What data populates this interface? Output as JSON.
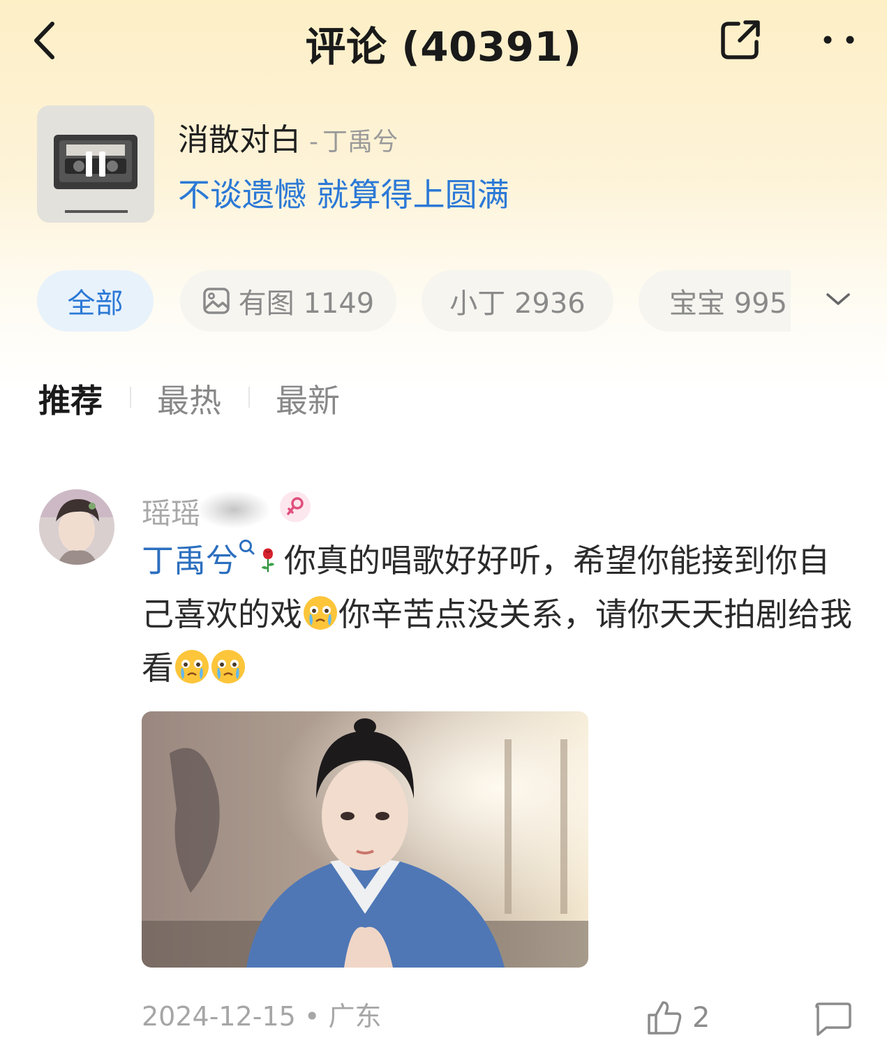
{
  "header": {
    "title": "评论 (40391)",
    "icons": {
      "back": "back-chevron-icon",
      "share": "share-icon",
      "more": "more-dots-icon"
    }
  },
  "song": {
    "name": "消散对白",
    "separator": "-",
    "artist": "丁禹兮",
    "lyric": "不谈遗憾 就算得上圆满",
    "cover_icon": "pause-icon"
  },
  "filters": {
    "chips": [
      {
        "label": "全部",
        "active": true
      },
      {
        "label": "有图 1149",
        "icon": "image-icon"
      },
      {
        "label": "小丁 2936"
      },
      {
        "label": "宝宝 995"
      }
    ],
    "expand_icon": "chevron-down-icon"
  },
  "sort_tabs": [
    {
      "label": "推荐",
      "active": true
    },
    {
      "label": "最热"
    },
    {
      "label": "最新"
    }
  ],
  "comment": {
    "username": "瑶瑶",
    "mention": "丁禹兮",
    "text_part1": "你真的唱歌好好听，希望你能接到你自己喜欢的戏",
    "text_part2": "你辛苦点没关系，请你天天拍剧给我看",
    "date": "2024-12-15",
    "dot": "•",
    "location": "广东",
    "likes": "2"
  },
  "colors": {
    "accent": "#2c79d6",
    "header_bg": "#fdefc6",
    "chip_bg": "#f6f5f0",
    "chip_active_bg": "#e8f2fb"
  }
}
